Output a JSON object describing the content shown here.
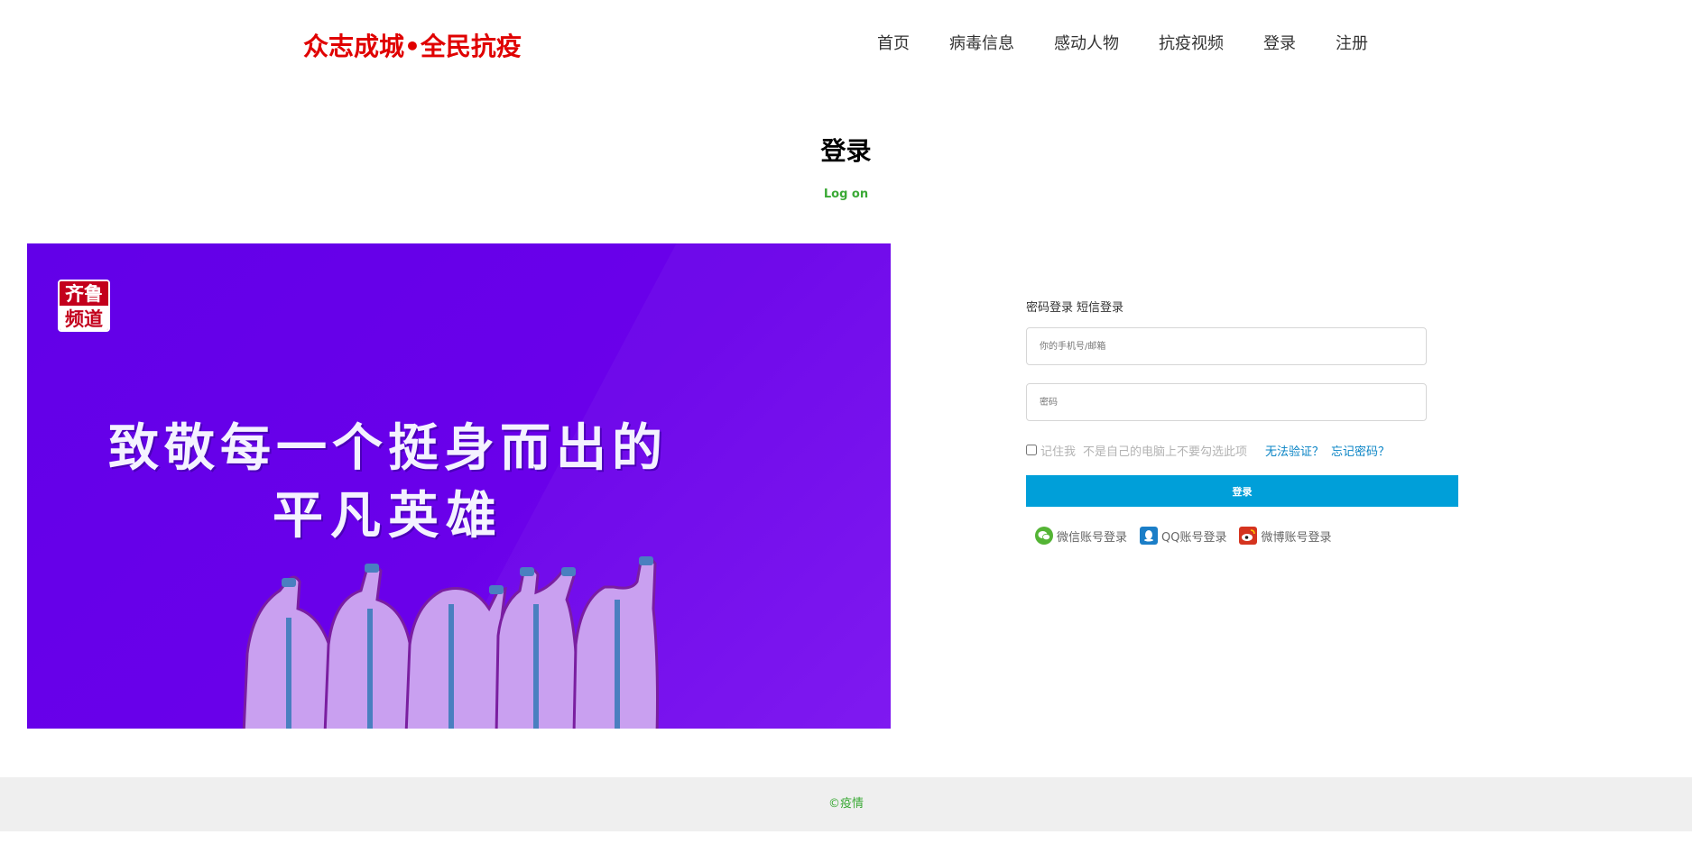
{
  "header": {
    "logo": "众志成城•全民抗疫",
    "nav": [
      "首页",
      "病毒信息",
      "感动人物",
      "抗疫视频",
      "登录",
      "注册"
    ]
  },
  "page": {
    "title": "登录",
    "subtitle": "Log on"
  },
  "banner": {
    "badge_line1": "齐鲁",
    "badge_line2": "频道",
    "headline_line1": "致敬每一个挺身而出的",
    "headline_line2": "平凡英雄"
  },
  "form": {
    "tab_password": "密码登录",
    "tab_sms": "短信登录",
    "account_placeholder": "你的手机号/邮箱",
    "password_placeholder": "密码",
    "remember_label": "记住我",
    "remember_hint": "不是自己的电脑上不要勾选此项",
    "cannot_verify": "无法验证？",
    "forgot_password": "忘记密码？",
    "login_button": "登录",
    "social": {
      "wechat": "微信账号登录",
      "qq": "QQ账号登录",
      "weibo": "微博账号登录"
    }
  },
  "footer": {
    "text": "©疫情"
  },
  "colors": {
    "logo": "#e00000",
    "accent_green": "#3aa935",
    "button_blue": "#009fd9",
    "banner_purple": "#6a00ea"
  }
}
